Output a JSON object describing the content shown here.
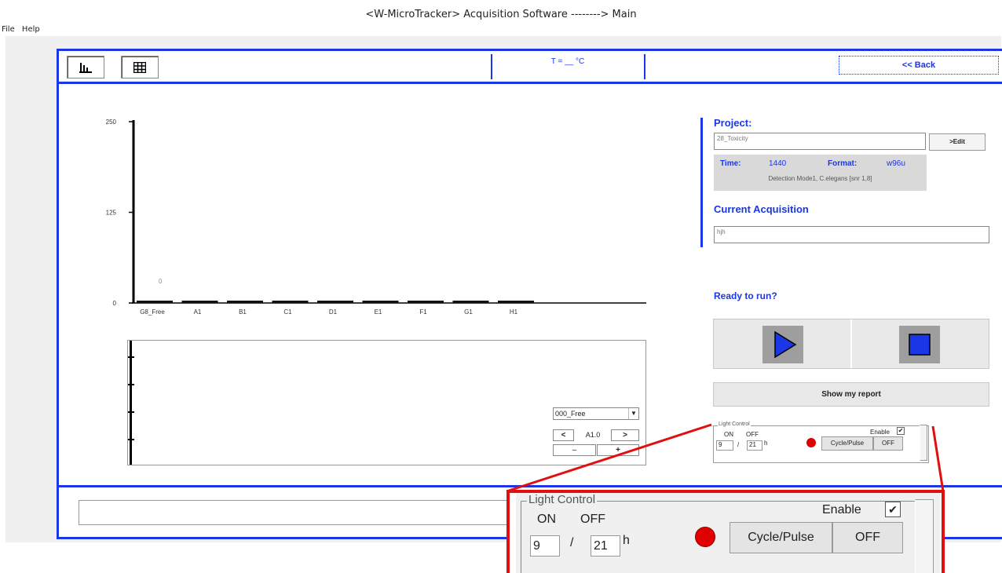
{
  "window": {
    "title": "<W-MicroTracker> Acquisition Software --------> Main"
  },
  "menu": {
    "items": [
      "File",
      "Help"
    ]
  },
  "toolbar": {
    "temperature": "T = __ °C",
    "back_label": "<< Back"
  },
  "chart_data": {
    "type": "bar",
    "categories": [
      "G8_Free",
      "A1",
      "B1",
      "C1",
      "D1",
      "E1",
      "F1",
      "G1",
      "H1"
    ],
    "values": [
      0,
      0,
      0,
      0,
      0,
      0,
      0,
      0,
      0
    ],
    "data_labels": [
      "0"
    ],
    "title": "",
    "xlabel": "",
    "ylabel": "",
    "ylim": [
      0,
      250
    ],
    "yticks": [
      "250",
      "125",
      "0"
    ],
    "grid": false
  },
  "secondary_panel": {
    "select_value": "000_Free",
    "position_label": "A1.0",
    "prev_label": "<",
    "next_label": ">",
    "minus_label": "–",
    "plus_label": "+"
  },
  "project": {
    "heading": "Project:",
    "name": "28_Toxicity",
    "edit_label": ">Edit",
    "time_label": "Time:",
    "time_value": "1440",
    "format_label": "Format:",
    "format_value": "w96u",
    "detection": "Detection Mode1, C.elegans [snr 1,8]"
  },
  "acquisition": {
    "heading": "Current Acquisition",
    "name": "hjh"
  },
  "run": {
    "heading": "Ready to run?",
    "report_label": "Show my report"
  },
  "light_control": {
    "legend": "Light Control",
    "on_label": "ON",
    "off_label": "OFF",
    "on_value": "9",
    "slash": "/",
    "off_value": "21",
    "unit": "h",
    "enable_label": "Enable",
    "enabled": true,
    "cycle_label": "Cycle/Pulse",
    "state_label": "OFF",
    "indicator_color": "#e00000"
  },
  "colors": {
    "accent": "#1a36e6",
    "highlight": "#e01010"
  }
}
